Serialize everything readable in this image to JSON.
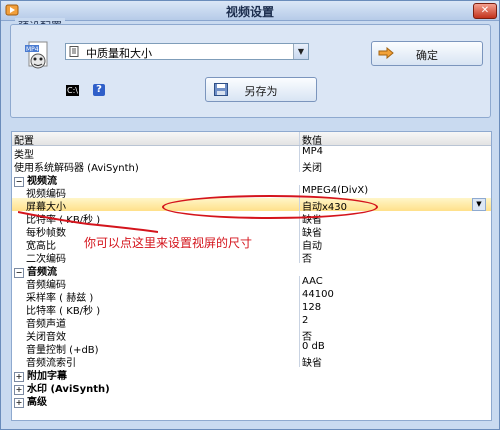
{
  "window": {
    "title": "视频设置"
  },
  "preset": {
    "legend": "预设配置",
    "selected": "中质量和大小",
    "ok_label": "确定",
    "saveas_label": "另存为",
    "cmd_icon_text": "C:\\"
  },
  "grid": {
    "header": {
      "key": "配置",
      "value": "数值"
    },
    "rows": [
      {
        "key": "类型",
        "value": "MP4"
      },
      {
        "key": "使用系统解码器 (AviSynth)",
        "value": "关闭"
      },
      {
        "key": "视频流",
        "value": ""
      },
      {
        "key": "视频编码",
        "value": "MPEG4(DivX)"
      },
      {
        "key": "屏幕大小",
        "value": "自动x430"
      },
      {
        "key": "比特率 ( KB/秒 )",
        "value": "缺省"
      },
      {
        "key": "每秒帧数",
        "value": "缺省"
      },
      {
        "key": "宽高比",
        "value": "自动"
      },
      {
        "key": "二次编码",
        "value": "否"
      },
      {
        "key": "音频流",
        "value": ""
      },
      {
        "key": "音频编码",
        "value": "AAC"
      },
      {
        "key": "采样率 ( 赫兹 )",
        "value": "44100"
      },
      {
        "key": "比特率 ( KB/秒 )",
        "value": "128"
      },
      {
        "key": "音频声道",
        "value": "2"
      },
      {
        "key": "关闭音效",
        "value": "否"
      },
      {
        "key": "音量控制 (+dB)",
        "value": "0 dB"
      },
      {
        "key": "音频流索引",
        "value": "缺省"
      },
      {
        "key": "附加字幕",
        "value": ""
      },
      {
        "key": "水印 (AviSynth)",
        "value": ""
      },
      {
        "key": "高级",
        "value": ""
      }
    ]
  },
  "annotation": {
    "text": "你可以点这里来设置视屏的尺寸",
    "color": "#d4141c"
  },
  "colors": {
    "window_bg": "#c9daf0",
    "highlight": "#ffe08a",
    "accent": "#2f5fc9"
  }
}
